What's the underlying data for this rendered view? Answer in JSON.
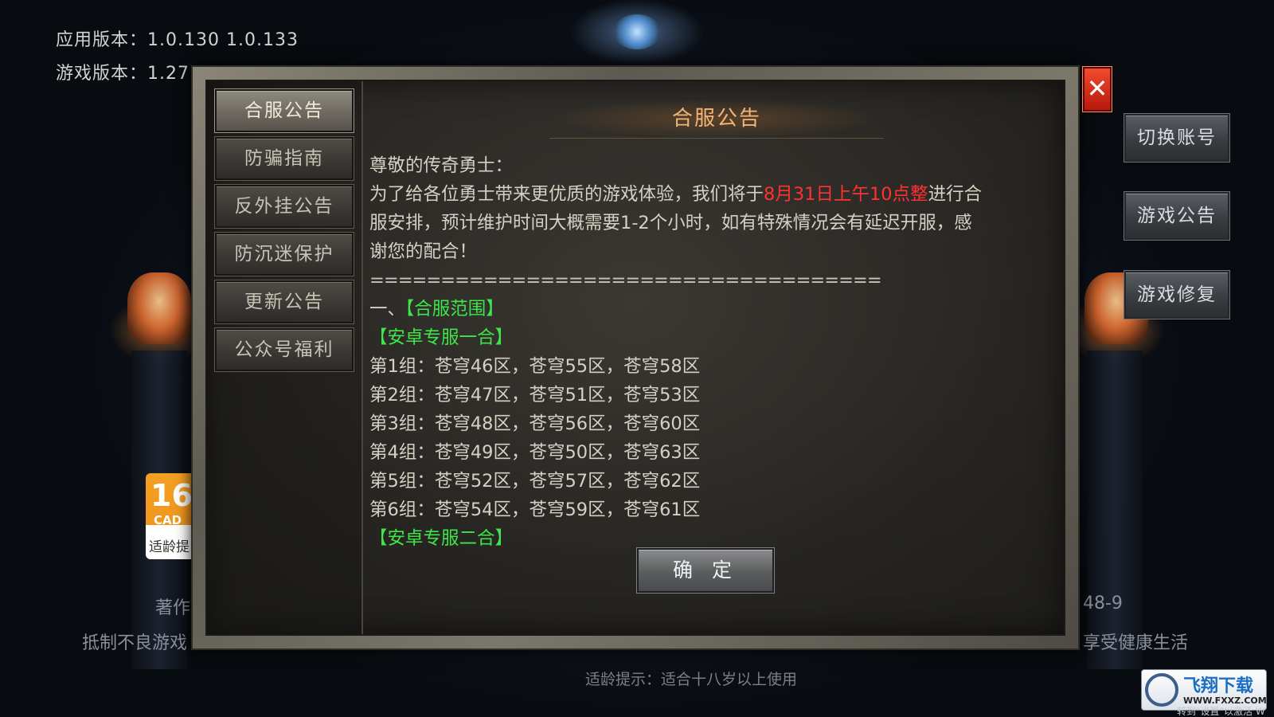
{
  "top_info": {
    "app_version": "应用版本：1.0.130  1.0.133",
    "game_version": "游戏版本：1.27"
  },
  "side_buttons": {
    "switch_account": "切换账号",
    "game_notice": "游戏公告",
    "game_repair": "游戏修复"
  },
  "age_badge": {
    "number": "16",
    "cadpa": "CAD",
    "label": "适龄提"
  },
  "background_text": {
    "left_line1": "著作",
    "left_line2": "抵制不良游戏",
    "right_line1": "48-9",
    "right_line2": "享受健康生活",
    "bottom_hint": "适龄提示：适合十八岁以上使用"
  },
  "dialog": {
    "tabs": [
      {
        "label": "合服公告",
        "active": true
      },
      {
        "label": "防骗指南",
        "active": false
      },
      {
        "label": "反外挂公告",
        "active": false
      },
      {
        "label": "防沉迷保护",
        "active": false
      },
      {
        "label": "更新公告",
        "active": false
      },
      {
        "label": "公众号福利",
        "active": false
      }
    ],
    "title": "合服公告",
    "greeting": "尊敬的传奇勇士：",
    "para_prefix": "为了给各位勇士带来更优质的游戏体验，我们将于",
    "para_highlight": "8月31日上午10点整",
    "para_suffix": "进行合",
    "para_line2": "服安排，预计维护时间大概需要1-2个小时，如有特殊情况会有延迟开服，感",
    "para_line3": "谢您的配合！",
    "divider": "====================================",
    "section_prefix": "一、",
    "section_title": "【合服范围】",
    "group1_title": "【安卓专服一合】",
    "groups": [
      "第1组：苍穹46区，苍穹55区，苍穹58区",
      "第2组：苍穹47区，苍穹51区，苍穹53区",
      "第3组：苍穹48区，苍穹56区，苍穹60区",
      "第4组：苍穹49区，苍穹50区，苍穹63区",
      "第5组：苍穹52区，苍穹57区，苍穹62区",
      "第6组：苍穹54区，苍穹59区，苍穹61区"
    ],
    "group2_title": "【安卓专服二合】",
    "confirm_label": "确 定",
    "close_icon": "✕"
  },
  "watermark": {
    "title": "飞翔下载",
    "url": "WWW.FXXZ.COM",
    "activate_hint": "转到\"设置\"以激活 W"
  },
  "colors": {
    "highlight_red": "#ff3131",
    "highlight_green": "#3ee64a",
    "title_orange": "#f2b47a",
    "close_red": "#d62a18"
  }
}
